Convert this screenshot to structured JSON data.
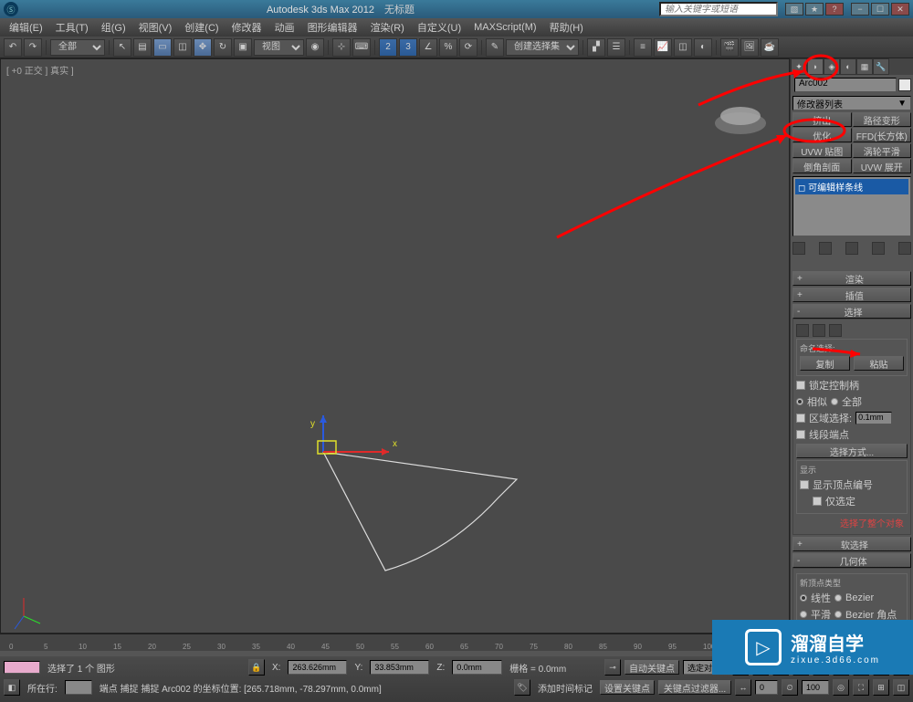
{
  "title": {
    "app": "Autodesk 3ds Max 2012",
    "untitled": "无标题",
    "search_placeholder": "输入关键字或短语"
  },
  "menu": [
    "编辑(E)",
    "工具(T)",
    "组(G)",
    "视图(V)",
    "创建(C)",
    "修改器",
    "动画",
    "图形编辑器",
    "渲染(R)",
    "自定义(U)",
    "MAXScript(M)",
    "帮助(H)"
  ],
  "toolbar": {
    "dropdown1": "全部",
    "view_label": "视图",
    "selset": "创建选择集"
  },
  "viewport": {
    "label": "[ +0 正交 ] 真实 ]",
    "gizmo_y": "y",
    "gizmo_x": "x"
  },
  "right": {
    "object_name": "Arc002",
    "modifier_dropdown": "修改器列表",
    "mod_buttons": [
      "挤出",
      "路径变形",
      "优化",
      "FFD(长方体)",
      "UVW 贴图",
      "涡轮平滑",
      "倒角剖面",
      "UVW 展开"
    ],
    "stack_item": "可编辑样条线",
    "rollouts": {
      "render": "渲染",
      "interp": "插值",
      "select": "选择",
      "softsel": "软选择",
      "geom": "几何体"
    },
    "named_sel": {
      "title": "命名选择:",
      "copy": "复制",
      "paste": "粘贴"
    },
    "lock_handles": "锁定控制柄",
    "radio_similar": "相似",
    "radio_all": "全部",
    "area_sel": "区域选择:",
    "area_val": "0.1mm",
    "seg_end": "线段端点",
    "sel_method": "选择方式...",
    "display_group": "显示",
    "show_vtx_num": "显示顶点编号",
    "only_sel": "仅选定",
    "sel_status": "选择了整个对象",
    "new_vtx_type": "新顶点类型",
    "vtx_linear": "线性",
    "vtx_bezier": "Bezier",
    "vtx_smooth": "平滑",
    "vtx_bezier_corner": "Bezier 角点"
  },
  "timeline": {
    "start": 0,
    "end": 100,
    "step": 5
  },
  "status": {
    "selection_count": "选择了 1 个 图形",
    "x_label": "X:",
    "x_val": "263.626mm",
    "y_label": "Y:",
    "y_val": "33.853mm",
    "z_label": "Z:",
    "z_val": "0.0mm",
    "grid": "栅格 = 0.0mm",
    "auto_key": "自动关键点",
    "seldep": "选定对象",
    "line_label": "所在行:",
    "snap_msg": "端点 捕捉 捕捉 Arc002 的坐标位置: [265.718mm, -78.297mm, 0.0mm]",
    "add_marker": "添加时间标记",
    "set_key": "设置关键点",
    "key_filter": "关键点过滤器...",
    "frame": "0",
    "frame_end": "100"
  },
  "watermark": {
    "main": "溜溜自学",
    "sub": "zixue.3d66.com"
  }
}
